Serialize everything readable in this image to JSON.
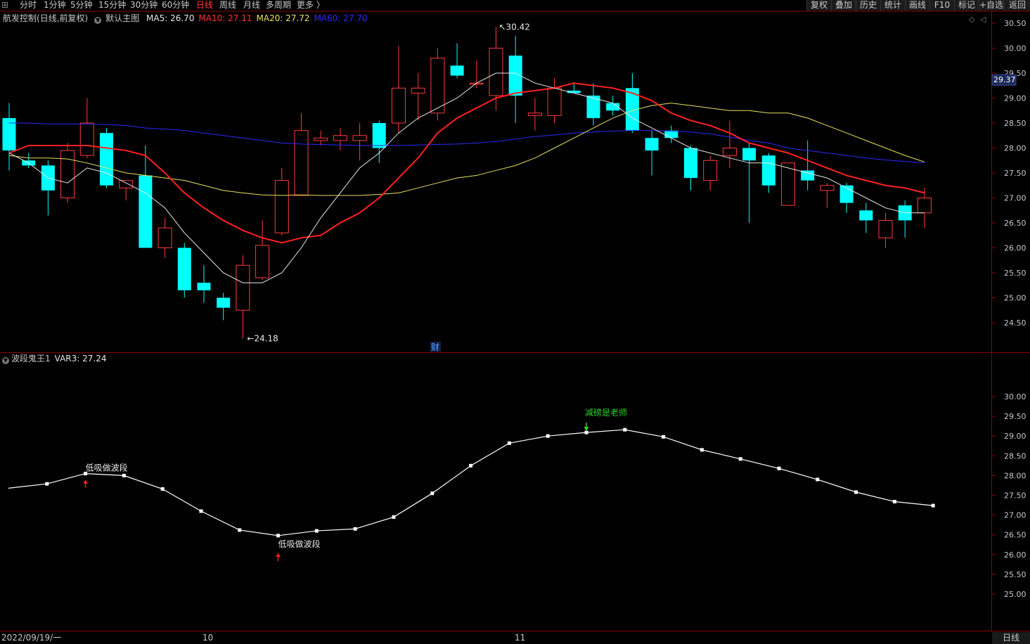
{
  "toolbar": {
    "periods": [
      "分时",
      "1分钟",
      "5分钟",
      "15分钟",
      "30分钟",
      "60分钟",
      "日线",
      "周线",
      "月线",
      "多周期",
      "更多 〉"
    ],
    "active_period": "日线",
    "buttons": [
      "复权",
      "叠加",
      "历史",
      "统计",
      "画线",
      "F10",
      "标记",
      "+自选",
      "返回"
    ]
  },
  "main_panel": {
    "stock_title": "航发控制",
    "adjust": "(日线,前复权)",
    "template": "默认主图",
    "ma": [
      {
        "label": "MA5: 26.70",
        "color": "#e8e8e8"
      },
      {
        "label": "MA10: 27.11",
        "color": "#ff3030"
      },
      {
        "label": "MA20: 27.72",
        "color": "#e8e060"
      },
      {
        "label": "MA60: 27.70",
        "color": "#2a2aff"
      }
    ],
    "price_ticks": [
      "30.50",
      "30.00",
      "29.50",
      "29.00",
      "28.50",
      "28.00",
      "27.50",
      "27.00",
      "26.50",
      "26.00",
      "25.50",
      "25.00",
      "24.50"
    ],
    "current_price_tag": "29.37",
    "high_label": "30.42",
    "low_label": "24.18",
    "finance_marker": "财"
  },
  "indicator_panel": {
    "name": "波段鬼王1",
    "value_label": "VAR3: 27.24",
    "ticks": [
      "30.00",
      "29.50",
      "29.00",
      "28.50",
      "28.00",
      "27.50",
      "27.00",
      "26.50",
      "26.00",
      "25.50",
      "25.00"
    ],
    "signals": [
      {
        "text": "低吸做波段",
        "index": 2,
        "type": "buy"
      },
      {
        "text": "低吸做波段",
        "index": 7,
        "type": "buy"
      },
      {
        "text": "减磅是老师",
        "index": 15,
        "type": "sell"
      }
    ],
    "values": [
      27.68,
      27.79,
      28.05,
      28.0,
      27.66,
      27.1,
      26.62,
      26.48,
      26.6,
      26.65,
      26.95,
      27.55,
      28.25,
      28.82,
      29.0,
      29.09,
      29.16,
      28.98,
      28.65,
      28.42,
      28.18,
      27.9,
      27.58,
      27.34,
      27.24
    ]
  },
  "date_axis": {
    "start": "2022/09/19/一",
    "labels": [
      "10",
      "11"
    ],
    "period_label": "日线"
  },
  "colors": {
    "up": "#ff3b3b",
    "down": "#00ffff",
    "grid": "#8b0000",
    "ma5": "#e8e8e8",
    "ma10": "#ff2020",
    "ma20": "#e8e060",
    "ma60": "#2a2aff"
  },
  "chart_data": {
    "type": "candlestick",
    "candles": [
      {
        "o": 28.6,
        "h": 28.9,
        "l": 27.55,
        "c": 27.95
      },
      {
        "o": 27.75,
        "h": 27.9,
        "l": 27.6,
        "c": 27.65
      },
      {
        "o": 27.65,
        "h": 27.75,
        "l": 26.65,
        "c": 27.15
      },
      {
        "o": 27.0,
        "h": 28.1,
        "l": 26.9,
        "c": 27.95
      },
      {
        "o": 27.85,
        "h": 29.0,
        "l": 27.8,
        "c": 28.5
      },
      {
        "o": 28.3,
        "h": 28.4,
        "l": 27.2,
        "c": 27.25
      },
      {
        "o": 27.2,
        "h": 27.3,
        "l": 26.95,
        "c": 27.35
      },
      {
        "o": 27.45,
        "h": 28.05,
        "l": 26.0,
        "c": 26.0
      },
      {
        "o": 26.0,
        "h": 26.6,
        "l": 25.8,
        "c": 26.4
      },
      {
        "o": 26.0,
        "h": 26.1,
        "l": 25.0,
        "c": 25.15
      },
      {
        "o": 25.3,
        "h": 25.65,
        "l": 24.9,
        "c": 25.15
      },
      {
        "o": 25.0,
        "h": 25.1,
        "l": 24.55,
        "c": 24.8
      },
      {
        "o": 24.75,
        "h": 25.85,
        "l": 24.18,
        "c": 25.65
      },
      {
        "o": 25.4,
        "h": 26.55,
        "l": 25.35,
        "c": 26.05
      },
      {
        "o": 26.3,
        "h": 27.6,
        "l": 26.25,
        "c": 27.35
      },
      {
        "o": 27.05,
        "h": 28.7,
        "l": 27.05,
        "c": 28.35
      },
      {
        "o": 28.15,
        "h": 28.35,
        "l": 28.05,
        "c": 28.2
      },
      {
        "o": 28.15,
        "h": 28.4,
        "l": 27.95,
        "c": 28.25
      },
      {
        "o": 28.15,
        "h": 28.5,
        "l": 27.75,
        "c": 28.25
      },
      {
        "o": 28.5,
        "h": 28.55,
        "l": 27.7,
        "c": 28.0
      },
      {
        "o": 28.5,
        "h": 30.05,
        "l": 28.3,
        "c": 29.2
      },
      {
        "o": 29.1,
        "h": 29.5,
        "l": 28.55,
        "c": 29.2
      },
      {
        "o": 28.7,
        "h": 30.0,
        "l": 28.55,
        "c": 29.8
      },
      {
        "o": 29.65,
        "h": 30.1,
        "l": 29.4,
        "c": 29.45
      },
      {
        "o": 29.3,
        "h": 29.75,
        "l": 29.2,
        "c": 29.3
      },
      {
        "o": 29.05,
        "h": 30.42,
        "l": 28.75,
        "c": 30.0
      },
      {
        "o": 29.85,
        "h": 30.25,
        "l": 28.5,
        "c": 29.05
      },
      {
        "o": 28.65,
        "h": 29.0,
        "l": 28.35,
        "c": 28.7
      },
      {
        "o": 28.65,
        "h": 29.4,
        "l": 28.5,
        "c": 29.2
      },
      {
        "o": 29.15,
        "h": 29.3,
        "l": 29.1,
        "c": 29.1
      },
      {
        "o": 29.05,
        "h": 29.3,
        "l": 28.45,
        "c": 28.6
      },
      {
        "o": 28.9,
        "h": 29.05,
        "l": 28.65,
        "c": 28.75
      },
      {
        "o": 29.2,
        "h": 29.5,
        "l": 28.3,
        "c": 28.35
      },
      {
        "o": 28.2,
        "h": 28.35,
        "l": 27.45,
        "c": 27.95
      },
      {
        "o": 28.35,
        "h": 28.45,
        "l": 28.1,
        "c": 28.2
      },
      {
        "o": 28.0,
        "h": 28.05,
        "l": 27.15,
        "c": 27.4
      },
      {
        "o": 27.35,
        "h": 27.85,
        "l": 27.15,
        "c": 27.75
      },
      {
        "o": 27.85,
        "h": 28.55,
        "l": 27.6,
        "c": 28.0
      },
      {
        "o": 28.0,
        "h": 28.1,
        "l": 26.5,
        "c": 27.75
      },
      {
        "o": 27.85,
        "h": 27.9,
        "l": 27.1,
        "c": 27.25
      },
      {
        "o": 26.85,
        "h": 27.7,
        "l": 26.85,
        "c": 27.7
      },
      {
        "o": 27.55,
        "h": 28.15,
        "l": 27.15,
        "c": 27.35
      },
      {
        "o": 27.15,
        "h": 27.3,
        "l": 26.8,
        "c": 27.25
      },
      {
        "o": 27.25,
        "h": 27.3,
        "l": 26.7,
        "c": 26.9
      },
      {
        "o": 26.75,
        "h": 26.9,
        "l": 26.3,
        "c": 26.55
      },
      {
        "o": 26.2,
        "h": 26.7,
        "l": 26.0,
        "c": 26.55
      },
      {
        "o": 26.85,
        "h": 26.95,
        "l": 26.2,
        "c": 26.55
      },
      {
        "o": 26.7,
        "h": 27.2,
        "l": 26.4,
        "c": 27.0
      }
    ],
    "ma5": [
      27.9,
      27.7,
      27.4,
      27.3,
      27.6,
      27.5,
      27.3,
      27.1,
      26.8,
      26.3,
      25.9,
      25.5,
      25.3,
      25.3,
      25.5,
      26.0,
      26.6,
      27.1,
      27.6,
      27.9,
      28.3,
      28.6,
      28.8,
      29.0,
      29.3,
      29.5,
      29.5,
      29.3,
      29.2,
      29.1,
      29.0,
      28.9,
      28.6,
      28.4,
      28.2,
      28.0,
      27.9,
      27.8,
      27.7,
      27.7,
      27.6,
      27.5,
      27.4,
      27.2,
      27.0,
      26.8,
      26.7,
      26.7
    ],
    "ma10": [
      27.9,
      28.05,
      28.05,
      28.05,
      28.05,
      28.0,
      27.95,
      27.85,
      27.5,
      27.1,
      26.8,
      26.55,
      26.35,
      26.2,
      26.1,
      26.2,
      26.25,
      26.5,
      26.7,
      27.0,
      27.4,
      27.8,
      28.3,
      28.6,
      28.8,
      29.0,
      29.1,
      29.15,
      29.2,
      29.3,
      29.25,
      29.2,
      29.1,
      28.95,
      28.7,
      28.55,
      28.45,
      28.3,
      28.1,
      28.0,
      27.9,
      27.75,
      27.6,
      27.45,
      27.35,
      27.25,
      27.2,
      27.1
    ],
    "ma20": [
      27.85,
      27.8,
      27.8,
      27.78,
      27.7,
      27.6,
      27.5,
      27.45,
      27.4,
      27.35,
      27.25,
      27.15,
      27.1,
      27.06,
      27.05,
      27.06,
      27.05,
      27.05,
      27.05,
      27.07,
      27.1,
      27.2,
      27.3,
      27.4,
      27.45,
      27.55,
      27.65,
      27.8,
      28.0,
      28.2,
      28.4,
      28.6,
      28.75,
      28.85,
      28.9,
      28.85,
      28.8,
      28.75,
      28.75,
      28.7,
      28.7,
      28.6,
      28.45,
      28.3,
      28.15,
      28.0,
      27.85,
      27.72
    ],
    "ma60": [
      28.5,
      28.5,
      28.48,
      28.48,
      28.48,
      28.47,
      28.45,
      28.4,
      28.38,
      28.35,
      28.3,
      28.25,
      28.2,
      28.15,
      28.1,
      28.08,
      28.07,
      28.06,
      28.05,
      28.05,
      28.05,
      28.06,
      28.07,
      28.08,
      28.1,
      28.13,
      28.18,
      28.23,
      28.26,
      28.3,
      28.32,
      28.34,
      28.35,
      28.35,
      28.34,
      28.32,
      28.28,
      28.22,
      28.15,
      28.1,
      28.0,
      27.95,
      27.9,
      27.85,
      27.8,
      27.76,
      27.73,
      27.7
    ],
    "ylim": [
      24.0,
      30.7
    ]
  }
}
